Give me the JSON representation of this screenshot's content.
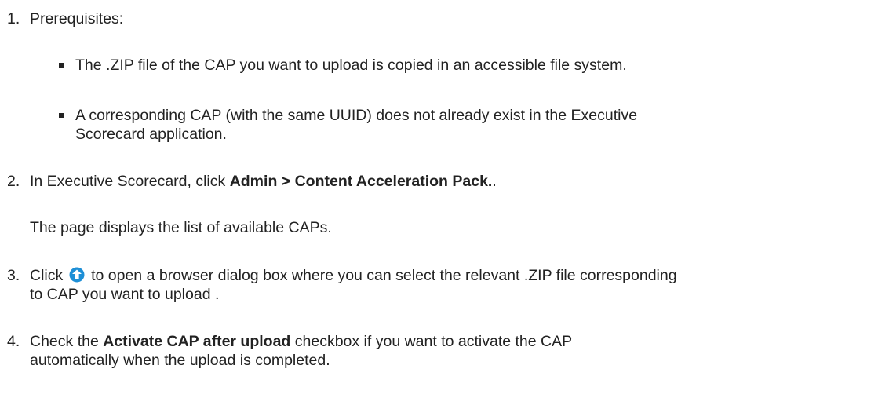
{
  "steps": [
    {
      "number": "1.",
      "text": "Prerequisites:",
      "bullets": [
        {
          "line1": "The .ZIP file of the CAP you want to upload is copied in an accessible file system."
        },
        {
          "line1": "A corresponding CAP (with the same UUID) does not already exist in the Executive",
          "line2": "Scorecard application."
        }
      ]
    },
    {
      "number": "2.",
      "prefix": "In Executive Scorecard, click ",
      "bold": "Admin > Content Acceleration Pack.",
      "suffix": ".",
      "note": "The page displays the list of available CAPs."
    },
    {
      "number": "3.",
      "prefix": "Click ",
      "icon": "upload-icon",
      "suffix": " to open a browser dialog box where you can select the relevant .ZIP file corresponding",
      "line2": "to CAP you want to upload ."
    },
    {
      "number": "4.",
      "prefix": "Check the ",
      "bold": "Activate CAP after upload",
      "suffix": " checkbox if you want to activate the CAP",
      "line2": "automatically when the upload is completed."
    }
  ],
  "colors": {
    "text": "#222222",
    "icon_blue": "#1e8fd6"
  }
}
